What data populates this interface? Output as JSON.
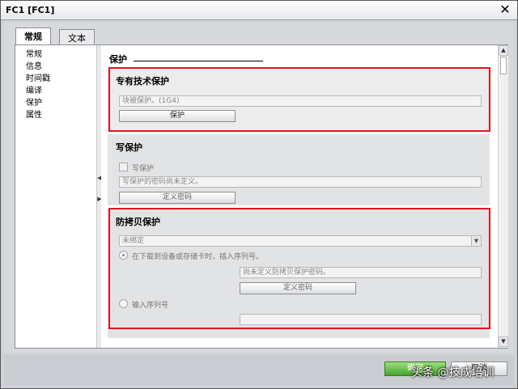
{
  "window": {
    "title": "FC1 [FC1]"
  },
  "tabs": [
    {
      "label": "常规"
    },
    {
      "label": "文本"
    }
  ],
  "nav": {
    "items": [
      {
        "label": "常规"
      },
      {
        "label": "信息"
      },
      {
        "label": "时间戳"
      },
      {
        "label": "编译"
      },
      {
        "label": "保护"
      },
      {
        "label": "属性"
      }
    ]
  },
  "main": {
    "heading": "保护",
    "know_how": {
      "title": "专有技术保护",
      "field": "块被保护。(1G4)",
      "button": "保护"
    },
    "write": {
      "title": "写保护",
      "checkbox_label": "写保护",
      "field": "写保护的密码尚未定义。",
      "button": "定义密码"
    },
    "copy": {
      "title": "防拷贝保护",
      "select": "未绑定",
      "radio1": "在下载到设备或存储卡时，插入序列号。",
      "password_field": "尚未定义防拷贝保护密码。",
      "button": "定义密码",
      "radio2": "输入序列号",
      "serial_field": ""
    }
  },
  "footer": {
    "ok": "确定",
    "cancel": "取消"
  },
  "watermark": "头条 @技成培训"
}
